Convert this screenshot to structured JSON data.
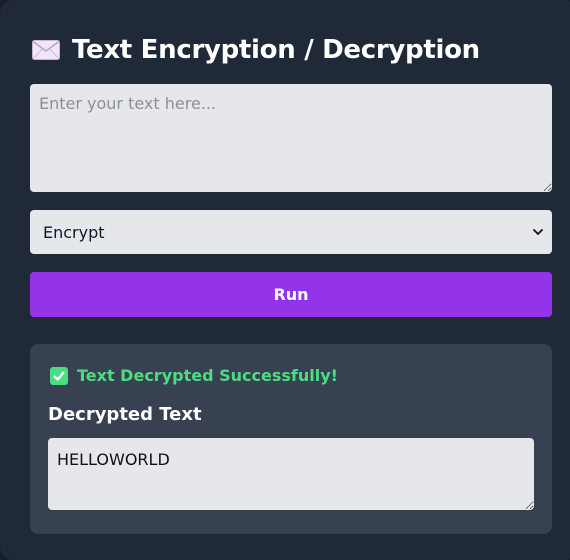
{
  "header": {
    "icon": "envelope-icon",
    "title": "Text Encryption / Decryption"
  },
  "input": {
    "value": "",
    "placeholder": "Enter your text here..."
  },
  "mode_select": {
    "selected": "Encrypt",
    "icon": "chevron-down-icon"
  },
  "run_button": {
    "label": "Run"
  },
  "result": {
    "status_icon": "check-icon",
    "status_text": "Text Decrypted Successfully!",
    "label": "Decrypted Text",
    "output": "HELLOWORLD"
  },
  "colors": {
    "background": "#1f2937",
    "accent": "#9333ea",
    "panel": "#374151",
    "success": "#4ade80",
    "field": "#e5e7eb"
  }
}
